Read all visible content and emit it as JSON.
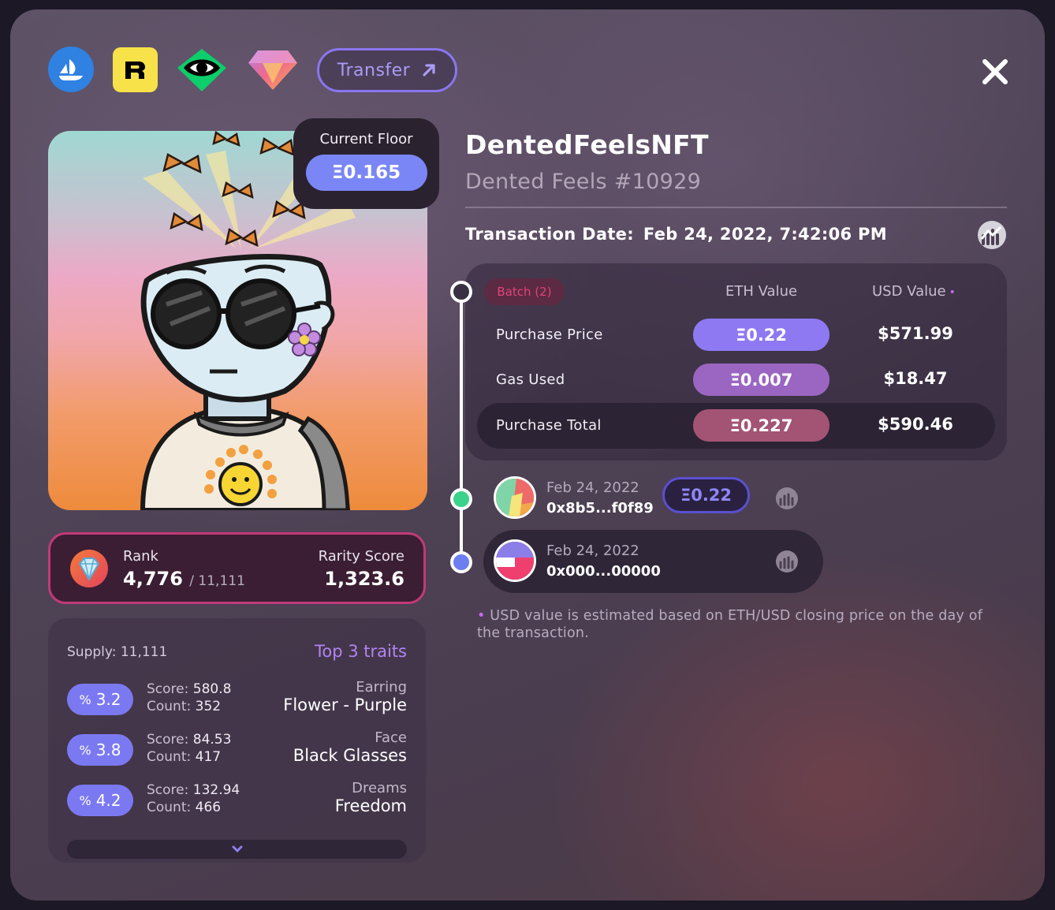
{
  "header": {
    "marketplaces": [
      "opensea-icon",
      "rarible-icon",
      "looksrare-icon",
      "gem-icon"
    ],
    "transfer_label": "Transfer",
    "close_icon": "close-icon"
  },
  "floor": {
    "label": "Current Floor",
    "value": "Ξ0.165"
  },
  "rank": {
    "label": "Rank",
    "value": "4,776",
    "total": "/ 11,111",
    "rarity_label": "Rarity Score",
    "rarity_value": "1,323.6"
  },
  "traits": {
    "supply": "Supply: 11,111",
    "title": "Top 3 traits",
    "items": [
      {
        "pct": "3.2",
        "score_label": "Score:",
        "score": "580.8",
        "count_label": "Count:",
        "count": "352",
        "type": "Earring",
        "name": "Flower - Purple"
      },
      {
        "pct": "3.8",
        "score_label": "Score:",
        "score": "84.53",
        "count_label": "Count:",
        "count": "417",
        "type": "Face",
        "name": "Black Glasses"
      },
      {
        "pct": "4.2",
        "score_label": "Score:",
        "score": "132.94",
        "count_label": "Count:",
        "count": "466",
        "type": "Dreams",
        "name": "Freedom"
      }
    ],
    "pct_symbol": "%"
  },
  "nft": {
    "collection": "DentedFeelsNFT",
    "token": "Dented Feels #10929",
    "tx_date_label": "Transaction Date:",
    "tx_date": "Feb 24, 2022, 7:42:06 PM"
  },
  "values": {
    "batch": "Batch (2)",
    "eth_header": "ETH Value",
    "usd_header": "USD Value",
    "rows": [
      {
        "label": "Purchase Price",
        "eth": "Ξ0.22",
        "usd": "$571.99",
        "color": "#8e79f2"
      },
      {
        "label": "Gas Used",
        "eth": "Ξ0.007",
        "usd": "$18.47",
        "color": "#9a66c2"
      },
      {
        "label": "Purchase Total",
        "eth": "Ξ0.227",
        "usd": "$590.46",
        "color": "#a35475"
      }
    ]
  },
  "history": [
    {
      "date": "Feb 24, 2022",
      "address": "0x8b5...f0f89",
      "eth": "Ξ0.22"
    },
    {
      "date": "Feb 24, 2022",
      "address": "0x000...00000"
    }
  ],
  "note": "USD value is estimated based on ETH/USD closing price on the day of the transaction.",
  "colors": {
    "accent": "#7a86f5",
    "pink": "#c13a78",
    "purple": "#b184f3"
  }
}
